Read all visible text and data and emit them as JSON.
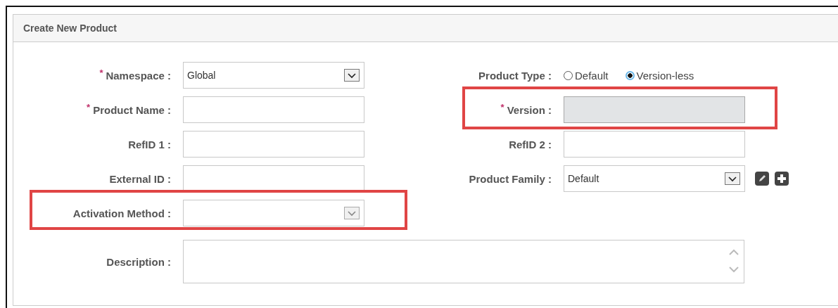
{
  "panel": {
    "title": "Create New Product"
  },
  "rows": [
    {
      "left": {
        "kind": "select",
        "required_mark": "*",
        "label": "Namespace :",
        "value": "Global",
        "highlighted": false
      },
      "right": {
        "kind": "radio",
        "label": "Product Type :",
        "options": [
          {
            "label": "Default",
            "selected": false
          },
          {
            "label": "Version-less",
            "selected": true
          }
        ]
      }
    },
    {
      "left": {
        "kind": "text",
        "required_mark": "*",
        "label": "Product Name :",
        "disabled": false,
        "highlighted": false
      },
      "right": {
        "kind": "text",
        "required_mark": "*",
        "label": "Version :",
        "disabled": true,
        "highlighted": true
      }
    },
    {
      "left": {
        "kind": "text",
        "label": "RefID 1 :",
        "disabled": false,
        "highlighted": false
      },
      "right": {
        "kind": "text",
        "label": "RefID 2 :",
        "disabled": false,
        "highlighted": false
      }
    },
    {
      "left": {
        "kind": "text",
        "label": "External ID :",
        "disabled": false,
        "highlighted": false
      },
      "right": {
        "kind": "select",
        "label": "Product Family :",
        "value": "Default",
        "highlighted": false,
        "edit_button": true,
        "add_button": true
      }
    },
    {
      "left": {
        "kind": "select",
        "label": "Activation Method :",
        "highlighted": true
      }
    }
  ],
  "description": {
    "label": "Description :"
  }
}
